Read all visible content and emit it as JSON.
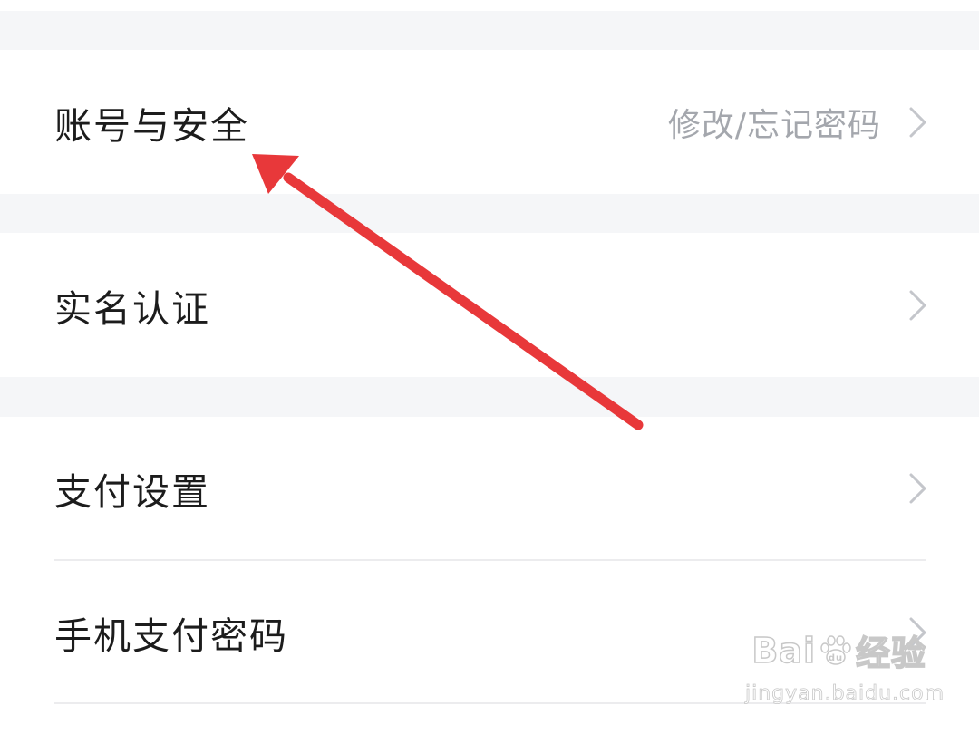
{
  "settings": {
    "items": [
      {
        "label": "账号与安全",
        "value": "修改/忘记密码"
      },
      {
        "label": "实名认证",
        "value": ""
      },
      {
        "label": "支付设置",
        "value": ""
      },
      {
        "label": "手机支付密码",
        "value": ""
      }
    ]
  },
  "annotation": {
    "arrow_color": "#e8383a",
    "arrow_target": "settings-row-account-security"
  },
  "watermark": {
    "logo_part1": "Bai",
    "logo_part2": "经验",
    "url": "jingyan.baidu.com"
  },
  "colors": {
    "section_gap": "#f5f6f8",
    "label_text": "#1c1c1c",
    "secondary_text": "#a4a7ad",
    "chevron": "#c4c6cb",
    "divider": "#ececee"
  }
}
